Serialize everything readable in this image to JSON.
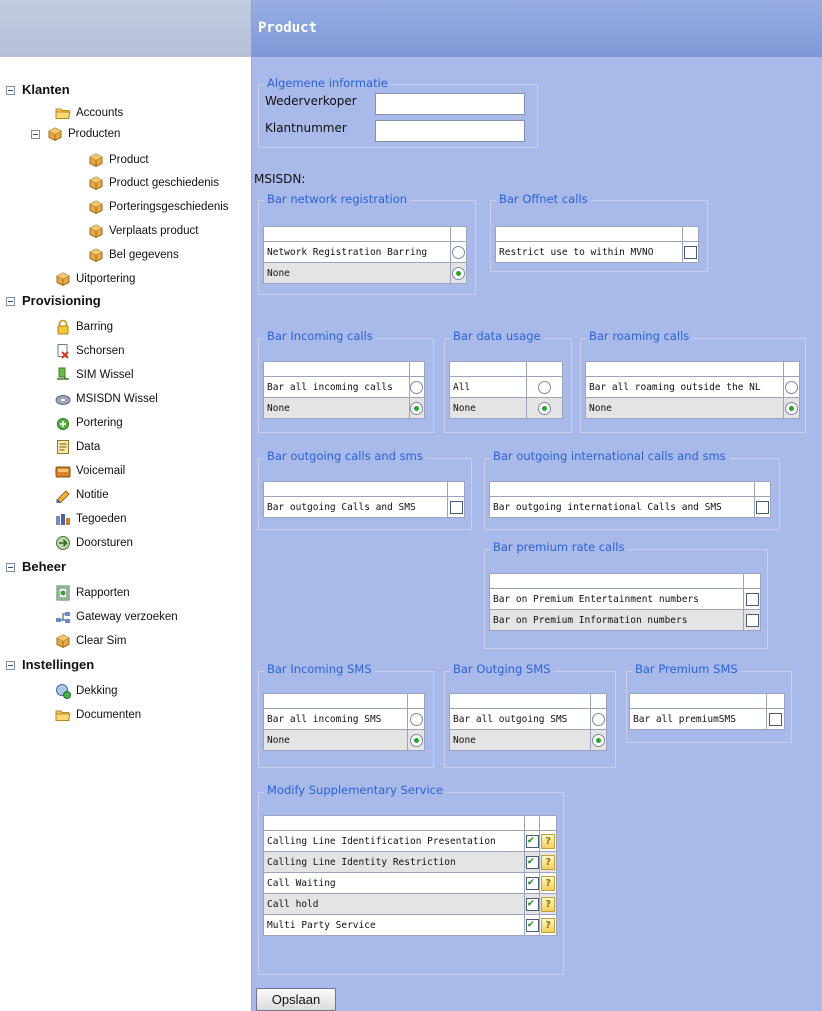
{
  "tree": {
    "klanten": {
      "label": "Klanten",
      "accounts": "Accounts",
      "producten": "Producten",
      "product": "Product",
      "product_geschiedenis": "Product geschiedenis",
      "porteringsgeschiedenis": "Porteringsgeschiedenis",
      "verplaats_product": "Verplaats product",
      "bel_gegevens": "Bel gegevens",
      "uitportering": "Uitportering"
    },
    "provisioning": {
      "label": "Provisioning",
      "barring": "Barring",
      "schorsen": "Schorsen",
      "sim_wissel": "SIM Wissel",
      "msisdn_wissel": "MSISDN Wissel",
      "portering": "Portering",
      "data": "Data",
      "voicemail": "Voicemail",
      "notitie": "Notitie",
      "tegoeden": "Tegoeden",
      "doorsturen": "Doorsturen"
    },
    "beheer": {
      "label": "Beheer",
      "rapporten": "Rapporten",
      "gateway": "Gateway verzoeken",
      "clear_sim": "Clear Sim"
    },
    "instellingen": {
      "label": "Instellingen",
      "dekking": "Dekking",
      "documenten": "Documenten"
    }
  },
  "page": {
    "title": "Product",
    "general": {
      "legend": "Algemene informatie",
      "wederverkoper_label": "Wederverkoper",
      "wederverkoper_value": "",
      "klantnummer_label": "Klantnummer",
      "klantnummer_value": ""
    },
    "msisdn_label": "MSISDN:",
    "bar_network": {
      "legend": "Bar network registration",
      "option": "Network Registration Barring",
      "none": "None",
      "selected": "None"
    },
    "bar_offnet": {
      "legend": "Bar Offnet calls",
      "option": "Restrict use to within MVNO",
      "checked": false
    },
    "bar_incoming": {
      "legend": "Bar Incoming calls",
      "option": "Bar all incoming calls",
      "none": "None",
      "selected": "None"
    },
    "bar_data": {
      "legend": "Bar data usage",
      "option": "All",
      "none": "None",
      "selected": "None"
    },
    "bar_roaming": {
      "legend": "Bar roaming calls",
      "option": "Bar all roaming outside the NL",
      "none": "None",
      "selected": "None"
    },
    "bar_outgoing": {
      "legend": "Bar outgoing calls and sms",
      "option": "Bar outgoing Calls and SMS",
      "checked": false
    },
    "bar_outgoing_intl": {
      "legend": "Bar outgoing international calls and sms",
      "option": "Bar outgoing international Calls and SMS",
      "checked": false
    },
    "bar_premium_rate": {
      "legend": "Bar premium rate calls",
      "option1": "Bar on Premium Entertainment numbers",
      "option2": "Bar on Premium Information numbers",
      "checked1": false,
      "checked2": false
    },
    "bar_incoming_sms": {
      "legend": "Bar Incoming SMS",
      "option": "Bar all incoming SMS",
      "none": "None",
      "selected": "None"
    },
    "bar_outging_sms": {
      "legend": "Bar Outging SMS",
      "option": "Bar all outgoing SMS",
      "none": "None",
      "selected": "None"
    },
    "bar_premium_sms": {
      "legend": "Bar Premium SMS",
      "option": "Bar all premiumSMS",
      "checked": false
    },
    "supplementary": {
      "legend": "Modify Supplementary Service",
      "rows": [
        {
          "label": "Calling Line Identification Presentation",
          "checked": true
        },
        {
          "label": "Calling Line Identity Restriction",
          "checked": true
        },
        {
          "label": "Call Waiting",
          "checked": true
        },
        {
          "label": "Call hold",
          "checked": true
        },
        {
          "label": "Multi Party Service",
          "checked": true
        }
      ]
    },
    "save_label": "Opslaan"
  }
}
